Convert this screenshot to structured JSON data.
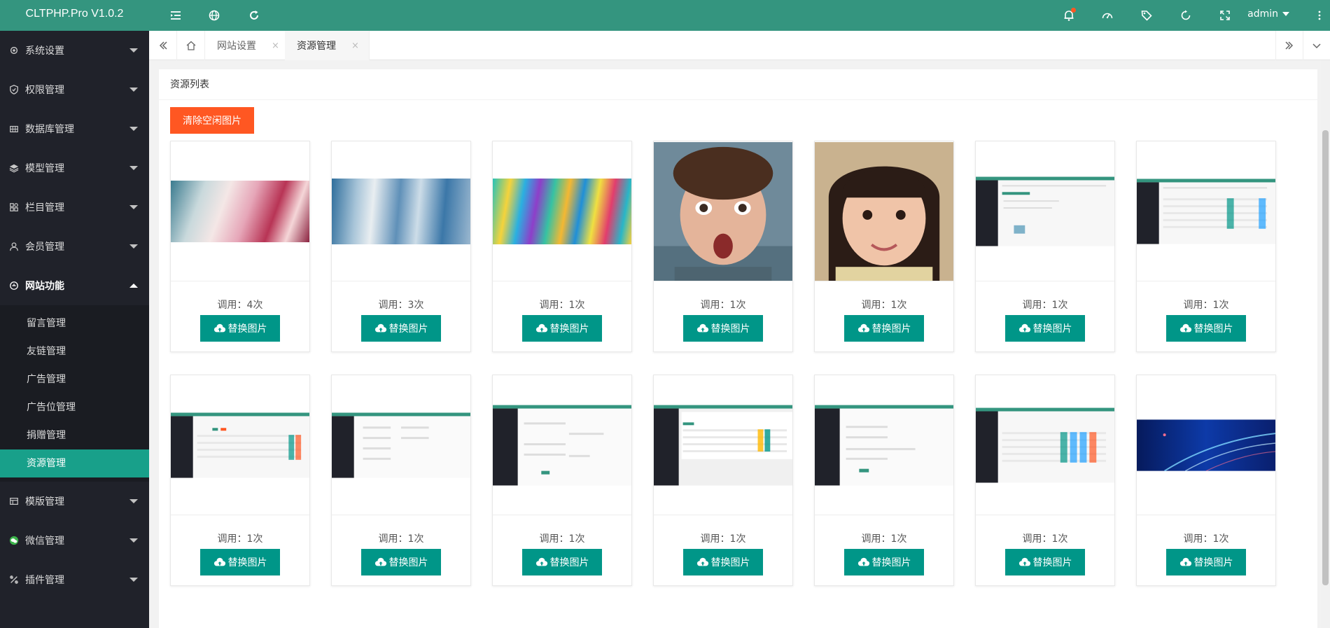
{
  "app_title": "CLTPHP.Pro V1.0.2",
  "colors": {
    "primary": "#009688",
    "header": "#34957f",
    "sidebar": "#20222a",
    "danger": "#ff5722"
  },
  "sidebar": {
    "items": [
      {
        "label": "系统设置",
        "icon": "gear-icon"
      },
      {
        "label": "权限管理",
        "icon": "shield-icon"
      },
      {
        "label": "数据库管理",
        "icon": "grid-icon"
      },
      {
        "label": "模型管理",
        "icon": "layers-icon"
      },
      {
        "label": "栏目管理",
        "icon": "apps-icon"
      },
      {
        "label": "会员管理",
        "icon": "user-icon"
      },
      {
        "label": "网站功能",
        "icon": "website-icon"
      },
      {
        "label": "模版管理",
        "icon": "template-icon"
      },
      {
        "label": "微信管理",
        "icon": "wechat-icon"
      },
      {
        "label": "插件管理",
        "icon": "plugin-icon"
      }
    ],
    "sub_items": [
      "留言管理",
      "友链管理",
      "广告管理",
      "广告位管理",
      "捐赠管理",
      "资源管理"
    ]
  },
  "header": {
    "user": "admin"
  },
  "tabs": [
    {
      "label": "网站设置",
      "close": "×"
    },
    {
      "label": "资源管理",
      "close": "×"
    }
  ],
  "page": {
    "title": "资源列表",
    "clear_button": "清除空闲图片"
  },
  "cards": [
    {
      "count": "调用：4次",
      "button": "替换图片",
      "image": "colorful-abstract-painting"
    },
    {
      "count": "调用：3次",
      "button": "替换图片",
      "image": "blue-abstract-painting"
    },
    {
      "count": "调用：1次",
      "button": "替换图片",
      "image": "vivid-colorful-painting"
    },
    {
      "count": "调用：1次",
      "button": "替换图片",
      "image": "surprised-boy-photo"
    },
    {
      "count": "调用：1次",
      "button": "替换图片",
      "image": "smiling-girl-photo"
    },
    {
      "count": "调用：1次",
      "button": "替换图片",
      "image": "admin-screenshot"
    },
    {
      "count": "调用：1次",
      "button": "替换图片",
      "image": "admin-screenshot"
    },
    {
      "count": "调用：1次",
      "button": "替换图片",
      "image": "admin-screenshot"
    },
    {
      "count": "调用：1次",
      "button": "替换图片",
      "image": "admin-screenshot"
    },
    {
      "count": "调用：1次",
      "button": "替换图片",
      "image": "admin-screenshot"
    },
    {
      "count": "调用：1次",
      "button": "替换图片",
      "image": "admin-screenshot"
    },
    {
      "count": "调用：1次",
      "button": "替换图片",
      "image": "admin-screenshot"
    },
    {
      "count": "调用：1次",
      "button": "替换图片",
      "image": "admin-screenshot"
    },
    {
      "count": "调用：1次",
      "button": "替换图片",
      "image": "blue-light-banner"
    }
  ]
}
